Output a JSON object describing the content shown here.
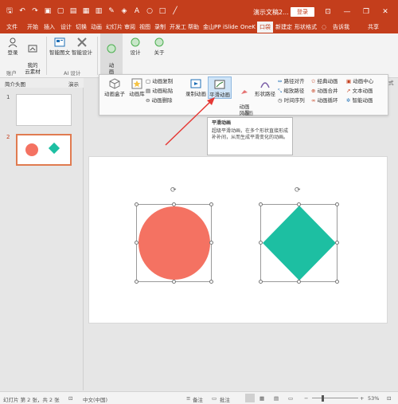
{
  "window": {
    "doc_title": "演示文稿2...",
    "login": "登录",
    "min": "—",
    "restore": "❐",
    "close": "✕"
  },
  "tabs": [
    "文件",
    "开始",
    "插入",
    "设计",
    "切换",
    "动画",
    "幻灯片",
    "审阅",
    "视图",
    "录制",
    "开发工",
    "帮助",
    "金山PP",
    "iSlide",
    "OneK",
    "口袋",
    "新建定",
    "形状格式",
    "告诉我",
    "共享"
  ],
  "active_tab": "口袋",
  "ribbon": {
    "login": "登录",
    "my_assets": "我的\n云素材",
    "smart_image": "智能图文",
    "smart_design": "智能设计",
    "anim": "动\n画",
    "design": "设计",
    "about": "关于",
    "group_account": "账户",
    "group_ai": "AI 设计"
  },
  "panel": {
    "anim_box": "动画盒子",
    "anim_lib": "动画库",
    "anim_copy": "动画复制",
    "anim_paste": "动画粘贴",
    "anim_delete": "动画删除",
    "record_anim": "录制动画",
    "smooth_anim": "平滑动画",
    "anim_style": "动画\n风暴",
    "shape_path": "形状路径",
    "path_align": "路径对齐",
    "scale_path": "缩放路径",
    "timeline": "时间序列",
    "classic_anim": "经典动画",
    "anim_merge": "动画合并",
    "anim_loop": "动画循环",
    "anim_center": "动画中心",
    "text_anim": "文本动画",
    "smart_anim": "智能动画",
    "group_label": "动画",
    "extra_label": "式"
  },
  "tooltip": {
    "title": "平滑动画",
    "body": "超级平滑动画，在多个形状直接形成补补间，从而生成平滑变化的动画。"
  },
  "leftpane": {
    "tab1": "简介头图",
    "tab2": "演示",
    "slide1_num": "1",
    "slide2_num": "2"
  },
  "statusbar": {
    "slide_info": "幻灯片 第 2 张，共 2 张",
    "language": "中文(中国)",
    "notes": "备注",
    "comments": "批注",
    "zoom": "53%"
  },
  "colors": {
    "brand": "#c43e1c",
    "circle": "#f47262",
    "diamond": "#1dbfa2",
    "highlight": "#cfe4f7"
  }
}
